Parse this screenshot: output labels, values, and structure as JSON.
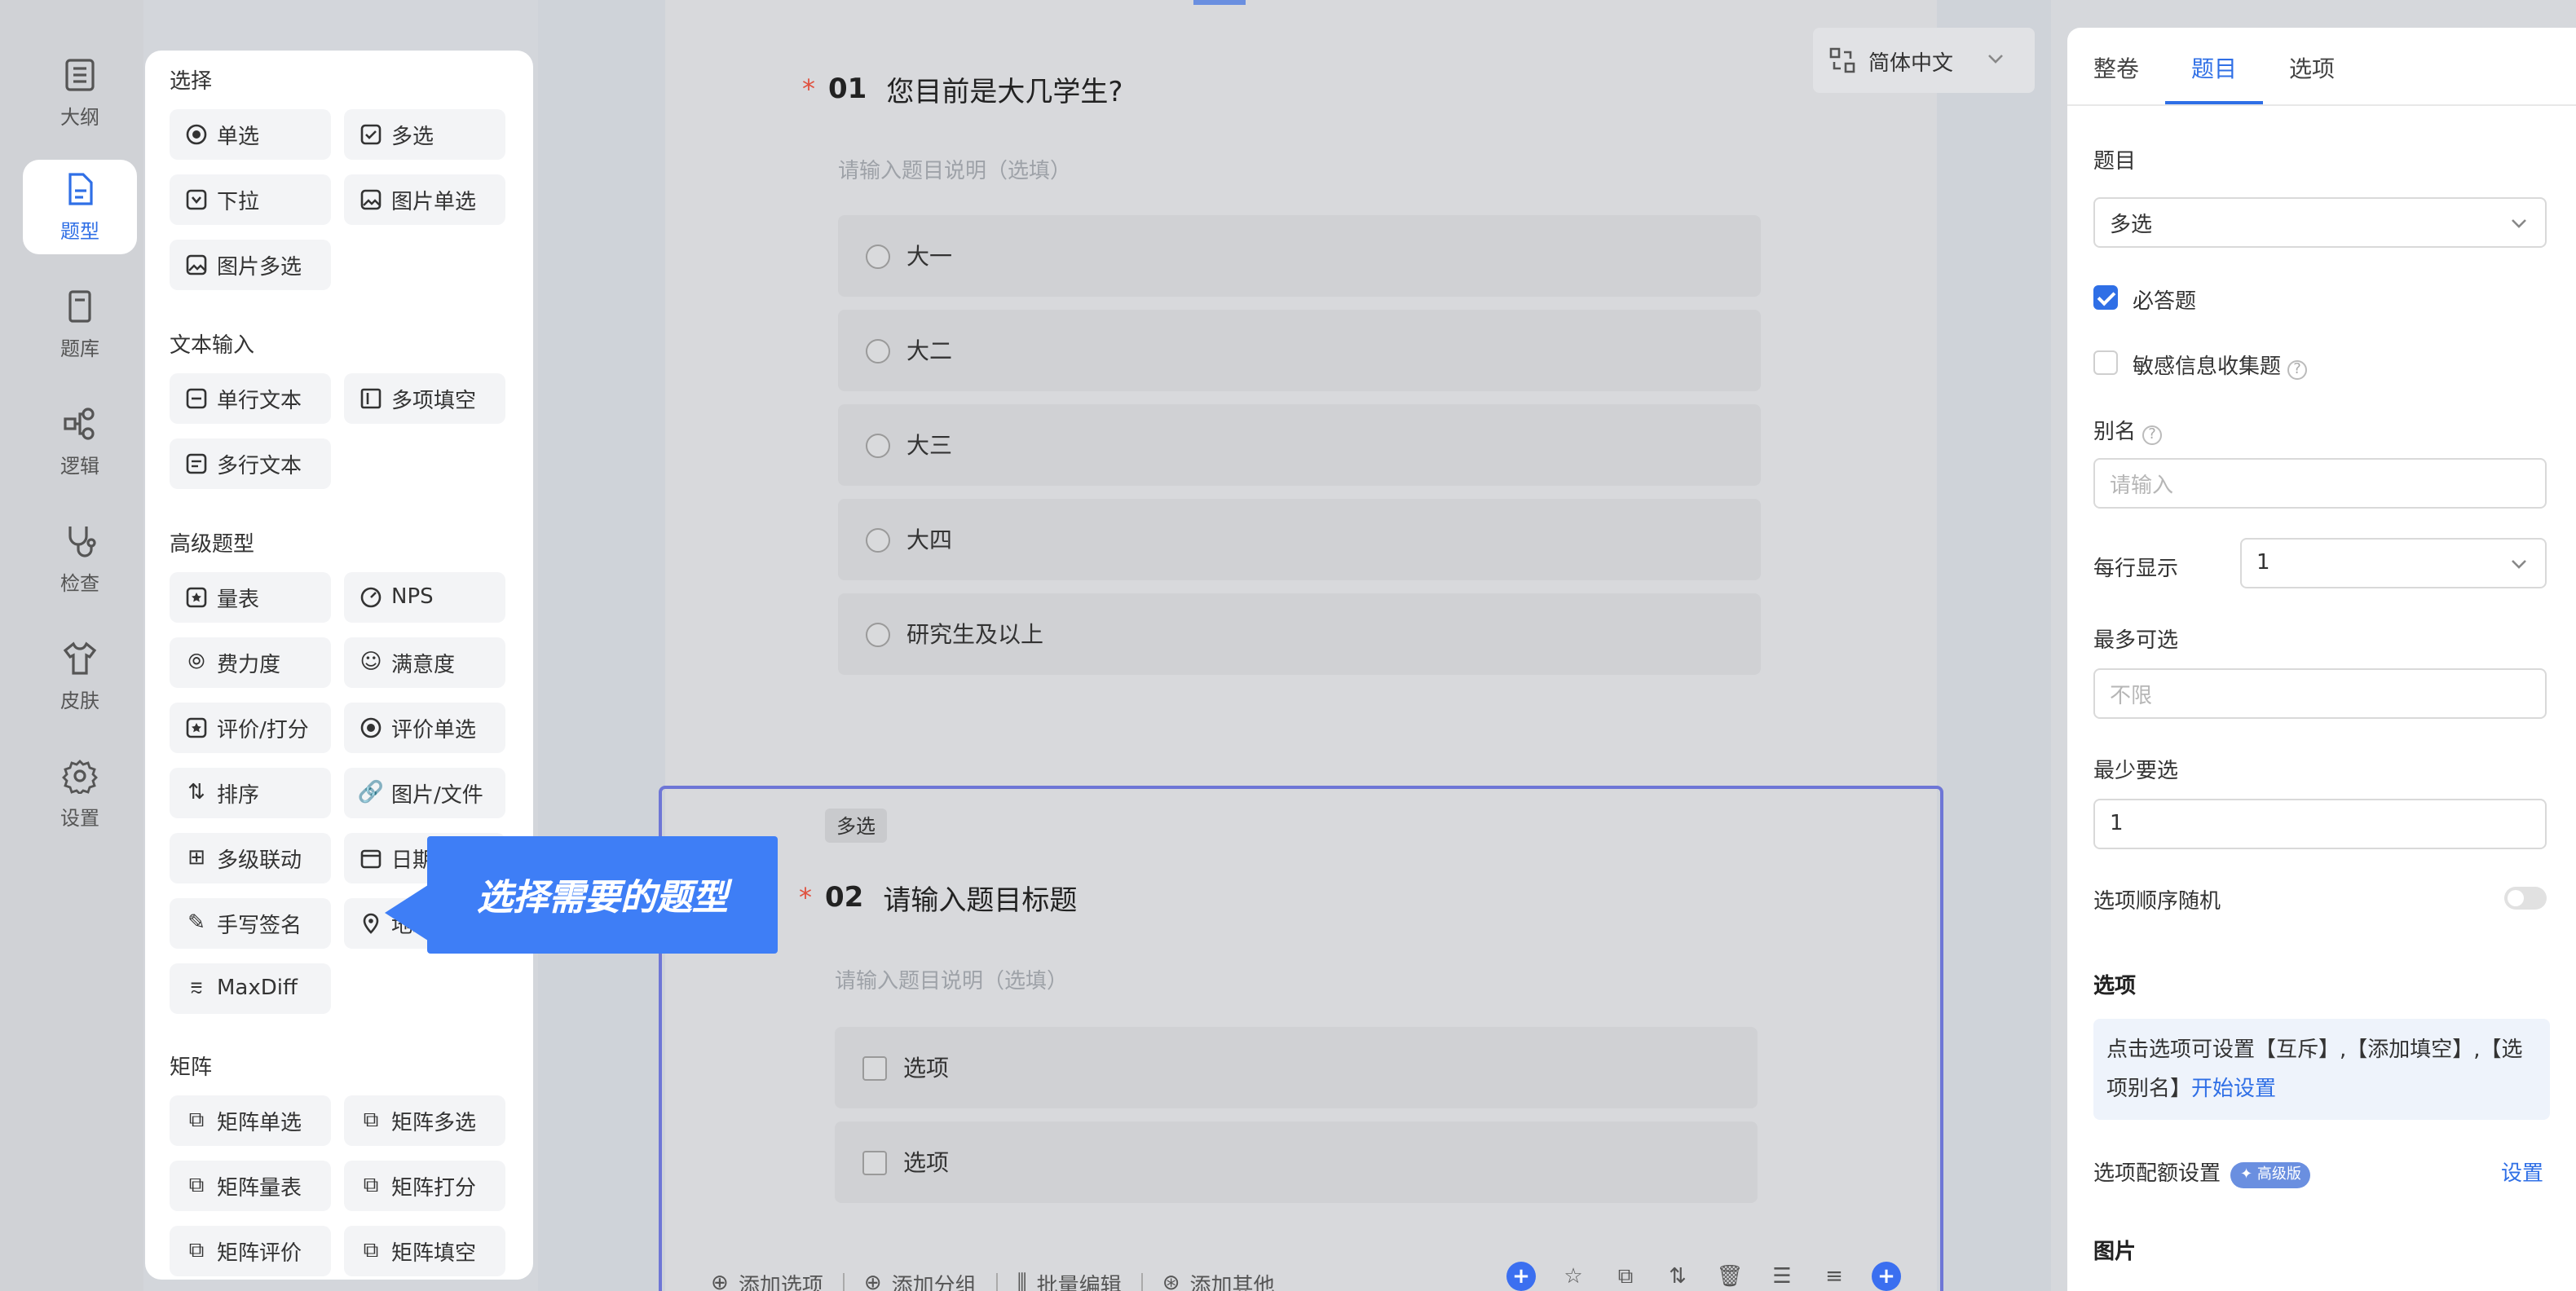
{
  "rail": {
    "items": [
      {
        "label": "大纲",
        "icon": "outline-icon"
      },
      {
        "label": "题型",
        "icon": "question-type-icon",
        "active": true
      },
      {
        "label": "题库",
        "icon": "question-bank-icon"
      },
      {
        "label": "逻辑",
        "icon": "logic-icon"
      },
      {
        "label": "检查",
        "icon": "check-icon"
      },
      {
        "label": "皮肤",
        "icon": "skin-icon"
      },
      {
        "label": "设置",
        "icon": "settings-icon"
      }
    ]
  },
  "types": {
    "choice": {
      "title": "选择",
      "items": [
        "单选",
        "多选",
        "下拉",
        "图片单选",
        "图片多选"
      ]
    },
    "text": {
      "title": "文本输入",
      "items": [
        "单行文本",
        "多项填空",
        "多行文本"
      ]
    },
    "advanced": {
      "title": "高级题型",
      "items": [
        "量表",
        "NPS",
        "费力度",
        "满意度",
        "评价/打分",
        "评价单选",
        "排序",
        "图片/文件",
        "多级联动",
        "日期",
        "手写签名",
        "地理位置",
        "MaxDiff"
      ]
    },
    "matrix": {
      "title": "矩阵",
      "items": [
        "矩阵单选",
        "矩阵多选",
        "矩阵量表",
        "矩阵打分",
        "矩阵评价",
        "矩阵填空"
      ]
    }
  },
  "tooltip": {
    "text": "选择需要的题型"
  },
  "language": {
    "label": "简体中文"
  },
  "q1": {
    "star": "*",
    "num": "01",
    "title": "您目前是大几学生?",
    "desc": "请输入题目说明（选填）",
    "options": [
      "大一",
      "大二",
      "大三",
      "大四",
      "研究生及以上"
    ]
  },
  "q2": {
    "badge": "多选",
    "star": "*",
    "num": "02",
    "title": "请输入题目标题",
    "desc": "请输入题目说明（选填）",
    "options": [
      "选项",
      "选项"
    ]
  },
  "toolbar": {
    "add_option": "添加选项",
    "add_group": "添加分组",
    "batch_edit": "批量编辑",
    "add_other": "添加其他"
  },
  "right": {
    "tabs": [
      "整卷",
      "题目",
      "选项"
    ],
    "question_label": "题目",
    "question_type_value": "多选",
    "required_label": "必答题",
    "required": true,
    "sensitive_label": "敏感信息收集题",
    "sensitive": false,
    "alias_label": "别名",
    "alias_placeholder": "请输入",
    "per_row_label": "每行显示",
    "per_row_value": "1",
    "max_label": "最多可选",
    "max_placeholder": "不限",
    "min_label": "最少要选",
    "min_value": "1",
    "random_label": "选项顺序随机",
    "options_section": "选项",
    "info_text": "点击选项可设置【互斥】,【添加填空】,【选项别名】",
    "info_link": "开始设置",
    "quota_label": "选项配额设置",
    "pro_badge": "✦ 高级版",
    "quota_link": "设置",
    "image_section": "图片"
  },
  "colors": {
    "accent": "#2f6fe6",
    "tooltip": "#3e7ef6",
    "selected_border": "#6e76d6"
  }
}
